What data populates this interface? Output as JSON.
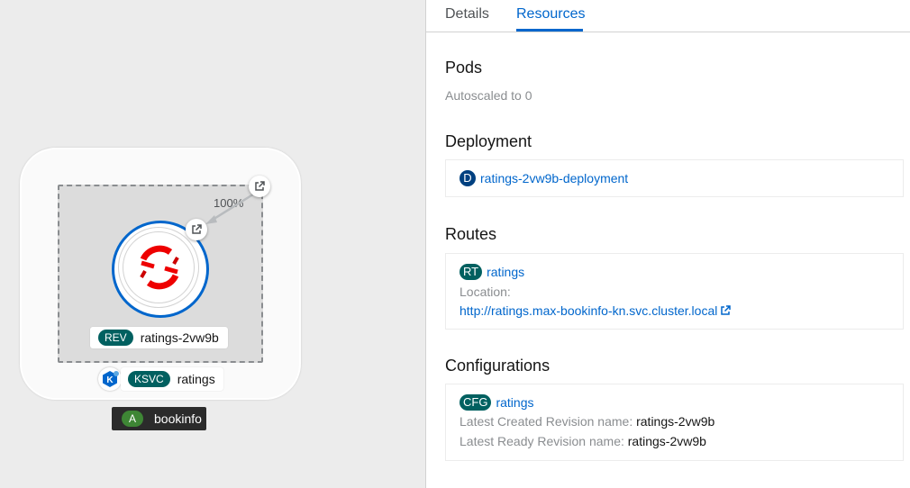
{
  "topology": {
    "traffic_percent": "100%",
    "revision": {
      "badge": "REV",
      "name": "ratings-2vw9b"
    },
    "service": {
      "badge": "KSVC",
      "name": "ratings"
    },
    "application": {
      "badge": "A",
      "name": "bookinfo"
    },
    "knative_icon": "K"
  },
  "panel": {
    "tabs": [
      {
        "label": "Details",
        "active": false
      },
      {
        "label": "Resources",
        "active": true
      }
    ],
    "pods": {
      "title": "Pods",
      "status": "Autoscaled to 0"
    },
    "deployment": {
      "title": "Deployment",
      "badge": "D",
      "name": "ratings-2vw9b-deployment"
    },
    "routes": {
      "title": "Routes",
      "badge": "RT",
      "name": "ratings",
      "location_label": "Location:",
      "location_url": "http://ratings.max-bookinfo-kn.svc.cluster.local"
    },
    "configurations": {
      "title": "Configurations",
      "badge": "CFG",
      "name": "ratings",
      "latest_created_label": "Latest Created Revision name:",
      "latest_created_value": "ratings-2vw9b",
      "latest_ready_label": "Latest Ready Revision name:",
      "latest_ready_value": "ratings-2vw9b"
    }
  },
  "colors": {
    "accent": "#0066cc",
    "teal_badge": "#006060",
    "app_badge": "#3e8635",
    "logo_red": "#ee0000"
  }
}
